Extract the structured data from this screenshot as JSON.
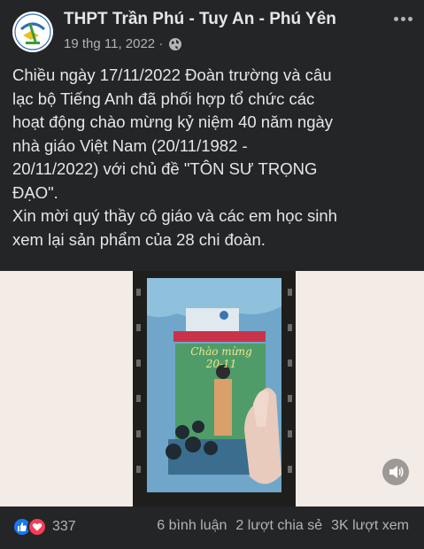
{
  "post": {
    "page_name": "THPT Trần Phú - Tuy An - Phú Yên",
    "date": "19 thg 11, 2022 ·",
    "privacy_icon": "globe-icon",
    "more_icon": "more-options-icon",
    "text_lines": [
      "Chiều ngày 17/11/2022 Đoàn trường và câu",
      "lạc bộ Tiếng Anh đã phối hợp tổ chức các",
      "hoạt động chào mừng kỷ niệm 40 năm ngày",
      "nhà giáo Việt Nam (20/11/1982 -",
      "20/11/2022) với chủ đề \"TÔN SƯ TRỌNG",
      "ĐẠO\".",
      "Xin mời quý thầy cô giáo và các em học sinh",
      "xem lại sản phẩm của 28 chi đoàn."
    ]
  },
  "video": {
    "card_text_line1": "Chào mừng",
    "card_text_line2": "20-11",
    "sound_icon": "speaker-icon"
  },
  "footer": {
    "reaction_icons": [
      "like-icon",
      "love-icon"
    ],
    "reaction_count": "337",
    "comments": "6 bình luận",
    "shares": "2 lượt chia sẻ",
    "views": "3K lượt xem"
  },
  "colors": {
    "background": "#242526",
    "text": "#e4e6eb",
    "secondary_text": "#b0b3b8",
    "like_blue": "#1877f2",
    "love_red": "#f33e58"
  }
}
